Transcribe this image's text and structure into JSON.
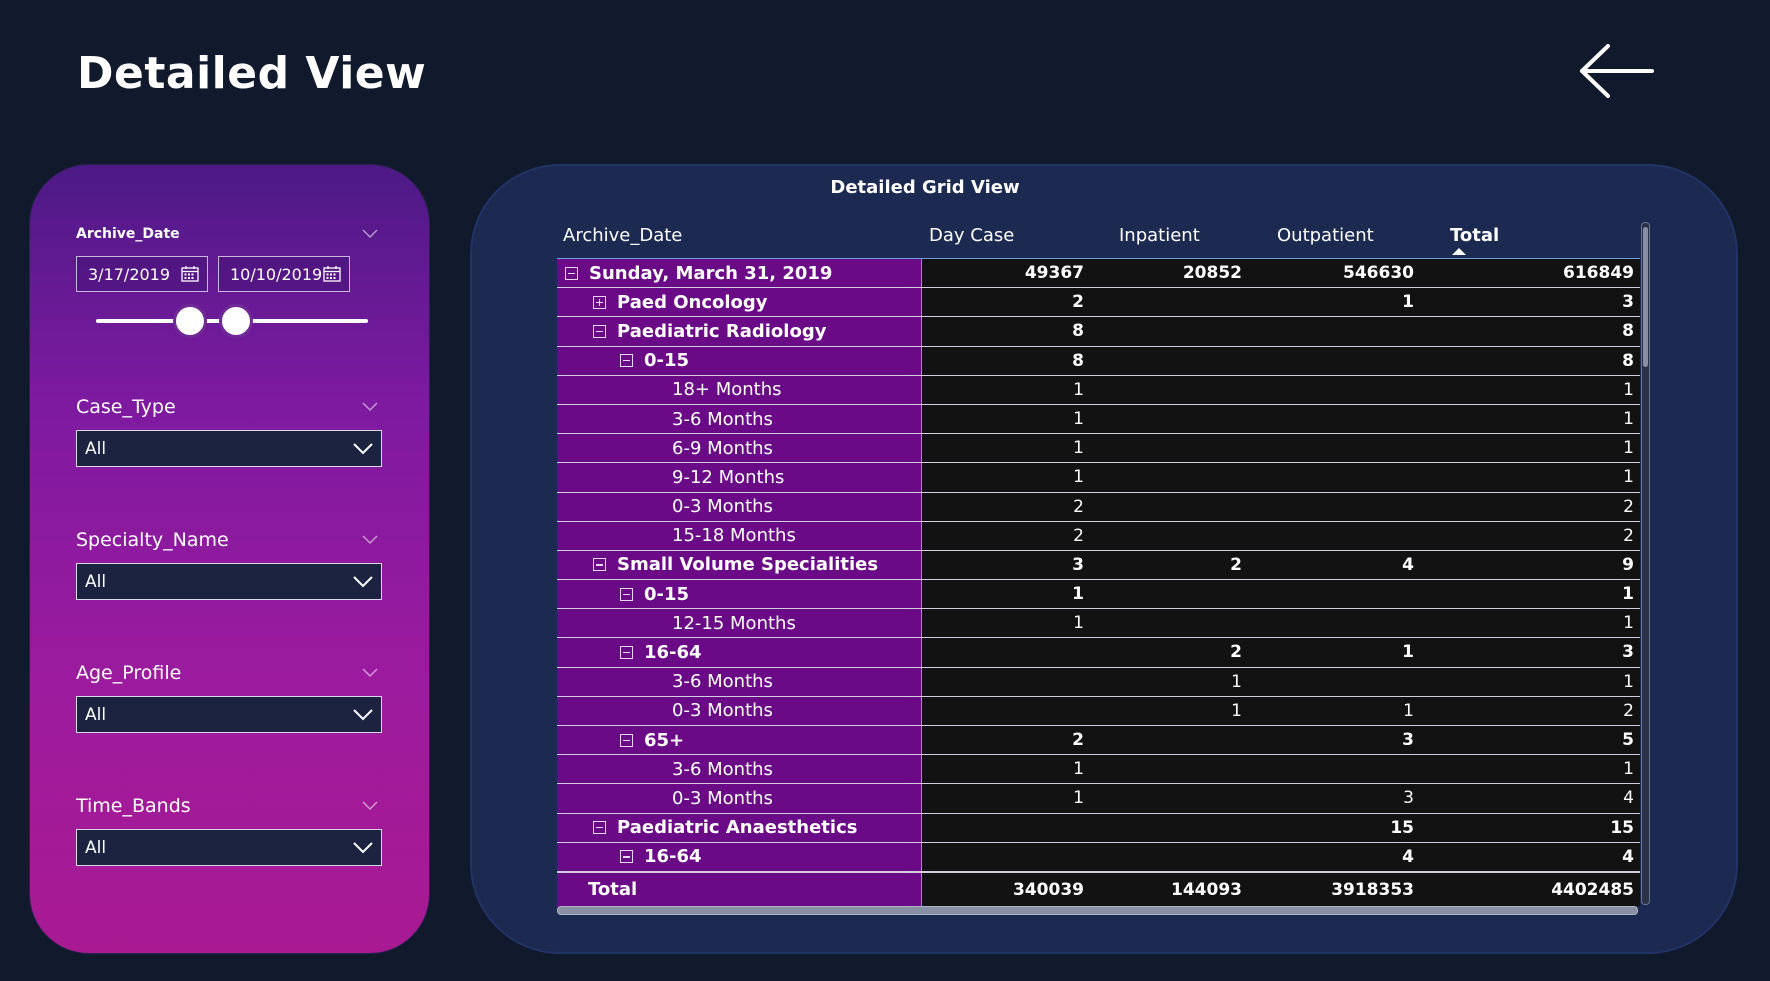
{
  "page": {
    "title": "Detailed View"
  },
  "filters": {
    "archive_date": {
      "label": "Archive_Date",
      "start": "3/17/2019",
      "end": "10/10/2019"
    },
    "case_type": {
      "label": "Case_Type",
      "value": "All"
    },
    "specialty_name": {
      "label": "Specialty_Name",
      "value": "All"
    },
    "age_profile": {
      "label": "Age_Profile",
      "value": "All"
    },
    "time_bands": {
      "label": "Time_Bands",
      "value": "All"
    }
  },
  "grid": {
    "title": "Detailed Grid View",
    "columns": [
      "Archive_Date",
      "Day Case",
      "Inpatient",
      "Outpatient",
      "Total"
    ],
    "sorted_column": "Total",
    "rows": [
      {
        "level": 0,
        "expander": "minus",
        "label": "Sunday, March 31, 2019",
        "bold": true,
        "day_case": "49367",
        "inpatient": "20852",
        "outpatient": "546630",
        "total": "616849"
      },
      {
        "level": 1,
        "expander": "plus",
        "label": "Paed Oncology",
        "bold": true,
        "day_case": "2",
        "inpatient": "",
        "outpatient": "1",
        "total": "3"
      },
      {
        "level": 1,
        "expander": "minus",
        "label": "Paediatric Radiology",
        "bold": true,
        "day_case": "8",
        "inpatient": "",
        "outpatient": "",
        "total": "8"
      },
      {
        "level": 2,
        "expander": "minus",
        "label": "0-15",
        "bold": true,
        "day_case": "8",
        "inpatient": "",
        "outpatient": "",
        "total": "8"
      },
      {
        "level": 3,
        "expander": "",
        "label": "18+ Months",
        "bold": false,
        "day_case": "1",
        "inpatient": "",
        "outpatient": "",
        "total": "1"
      },
      {
        "level": 3,
        "expander": "",
        "label": "3-6 Months",
        "bold": false,
        "day_case": "1",
        "inpatient": "",
        "outpatient": "",
        "total": "1"
      },
      {
        "level": 3,
        "expander": "",
        "label": "6-9 Months",
        "bold": false,
        "day_case": "1",
        "inpatient": "",
        "outpatient": "",
        "total": "1"
      },
      {
        "level": 3,
        "expander": "",
        "label": "9-12 Months",
        "bold": false,
        "day_case": "1",
        "inpatient": "",
        "outpatient": "",
        "total": "1"
      },
      {
        "level": 3,
        "expander": "",
        "label": "0-3 Months",
        "bold": false,
        "day_case": "2",
        "inpatient": "",
        "outpatient": "",
        "total": "2"
      },
      {
        "level": 3,
        "expander": "",
        "label": "15-18 Months",
        "bold": false,
        "day_case": "2",
        "inpatient": "",
        "outpatient": "",
        "total": "2"
      },
      {
        "level": 1,
        "expander": "minus",
        "label": "Small Volume Specialities",
        "bold": true,
        "day_case": "3",
        "inpatient": "2",
        "outpatient": "4",
        "total": "9"
      },
      {
        "level": 2,
        "expander": "minus",
        "label": "0-15",
        "bold": true,
        "day_case": "1",
        "inpatient": "",
        "outpatient": "",
        "total": "1"
      },
      {
        "level": 3,
        "expander": "",
        "label": "12-15 Months",
        "bold": false,
        "day_case": "1",
        "inpatient": "",
        "outpatient": "",
        "total": "1"
      },
      {
        "level": 2,
        "expander": "minus",
        "label": "16-64",
        "bold": true,
        "day_case": "",
        "inpatient": "2",
        "outpatient": "1",
        "total": "3"
      },
      {
        "level": 3,
        "expander": "",
        "label": "3-6 Months",
        "bold": false,
        "day_case": "",
        "inpatient": "1",
        "outpatient": "",
        "total": "1"
      },
      {
        "level": 3,
        "expander": "",
        "label": "0-3 Months",
        "bold": false,
        "day_case": "",
        "inpatient": "1",
        "outpatient": "1",
        "total": "2"
      },
      {
        "level": 2,
        "expander": "minus",
        "label": "65+",
        "bold": true,
        "day_case": "2",
        "inpatient": "",
        "outpatient": "3",
        "total": "5"
      },
      {
        "level": 3,
        "expander": "",
        "label": "3-6 Months",
        "bold": false,
        "day_case": "1",
        "inpatient": "",
        "outpatient": "",
        "total": "1"
      },
      {
        "level": 3,
        "expander": "",
        "label": "0-3 Months",
        "bold": false,
        "day_case": "1",
        "inpatient": "",
        "outpatient": "3",
        "total": "4"
      },
      {
        "level": 1,
        "expander": "minus",
        "label": "Paediatric Anaesthetics",
        "bold": true,
        "day_case": "",
        "inpatient": "",
        "outpatient": "15",
        "total": "15"
      },
      {
        "level": 2,
        "expander": "minus",
        "label": "16-64",
        "bold": true,
        "day_case": "",
        "inpatient": "",
        "outpatient": "4",
        "total": "4"
      }
    ],
    "total_row": {
      "label": "Total",
      "day_case": "340039",
      "inpatient": "144093",
      "outpatient": "3918353",
      "total": "4402485"
    }
  },
  "colors": {
    "background": "#111a2c",
    "panel_gradient_top": "#4c1a86",
    "panel_gradient_bottom": "#a91a92",
    "row_header": "#6b0a86",
    "value_cells": "#121212",
    "card": "#1c2a52"
  },
  "icons": [
    "back-arrow-icon",
    "calendar-icon",
    "chevron-down-icon",
    "expand-minus-icon",
    "expand-plus-icon",
    "sort-ascending-icon"
  ]
}
